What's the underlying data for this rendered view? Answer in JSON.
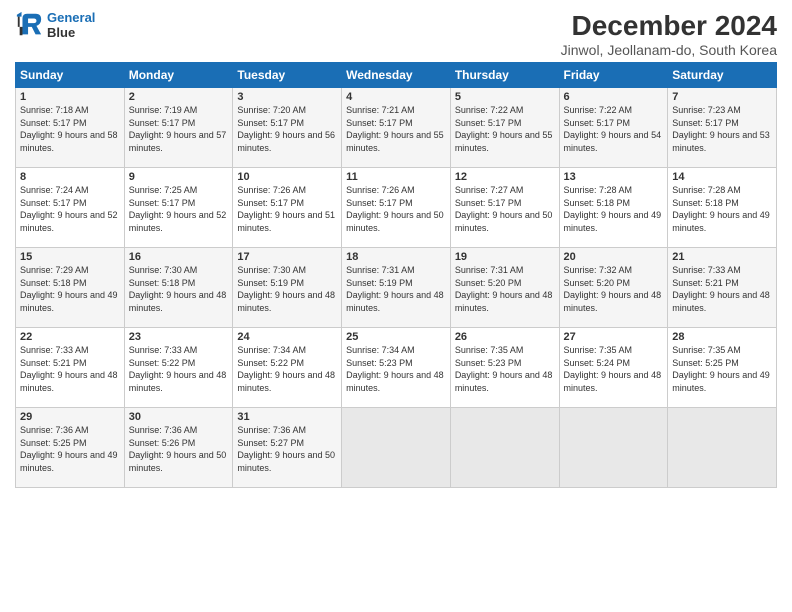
{
  "header": {
    "logo_line1": "General",
    "logo_line2": "Blue",
    "title": "December 2024",
    "subtitle": "Jinwol, Jeollanam-do, South Korea"
  },
  "calendar": {
    "days_of_week": [
      "Sunday",
      "Monday",
      "Tuesday",
      "Wednesday",
      "Thursday",
      "Friday",
      "Saturday"
    ],
    "weeks": [
      [
        {
          "day": "",
          "empty": true
        },
        {
          "day": "",
          "empty": true
        },
        {
          "day": "",
          "empty": true
        },
        {
          "day": "",
          "empty": true
        },
        {
          "day": "",
          "empty": true
        },
        {
          "day": "",
          "empty": true
        },
        {
          "day": "",
          "empty": true
        }
      ],
      [
        {
          "day": "1",
          "sunrise": "Sunrise: 7:18 AM",
          "sunset": "Sunset: 5:17 PM",
          "daylight": "Daylight: 9 hours and 58 minutes."
        },
        {
          "day": "2",
          "sunrise": "Sunrise: 7:19 AM",
          "sunset": "Sunset: 5:17 PM",
          "daylight": "Daylight: 9 hours and 57 minutes."
        },
        {
          "day": "3",
          "sunrise": "Sunrise: 7:20 AM",
          "sunset": "Sunset: 5:17 PM",
          "daylight": "Daylight: 9 hours and 56 minutes."
        },
        {
          "day": "4",
          "sunrise": "Sunrise: 7:21 AM",
          "sunset": "Sunset: 5:17 PM",
          "daylight": "Daylight: 9 hours and 55 minutes."
        },
        {
          "day": "5",
          "sunrise": "Sunrise: 7:22 AM",
          "sunset": "Sunset: 5:17 PM",
          "daylight": "Daylight: 9 hours and 55 minutes."
        },
        {
          "day": "6",
          "sunrise": "Sunrise: 7:22 AM",
          "sunset": "Sunset: 5:17 PM",
          "daylight": "Daylight: 9 hours and 54 minutes."
        },
        {
          "day": "7",
          "sunrise": "Sunrise: 7:23 AM",
          "sunset": "Sunset: 5:17 PM",
          "daylight": "Daylight: 9 hours and 53 minutes."
        }
      ],
      [
        {
          "day": "8",
          "sunrise": "Sunrise: 7:24 AM",
          "sunset": "Sunset: 5:17 PM",
          "daylight": "Daylight: 9 hours and 52 minutes."
        },
        {
          "day": "9",
          "sunrise": "Sunrise: 7:25 AM",
          "sunset": "Sunset: 5:17 PM",
          "daylight": "Daylight: 9 hours and 52 minutes."
        },
        {
          "day": "10",
          "sunrise": "Sunrise: 7:26 AM",
          "sunset": "Sunset: 5:17 PM",
          "daylight": "Daylight: 9 hours and 51 minutes."
        },
        {
          "day": "11",
          "sunrise": "Sunrise: 7:26 AM",
          "sunset": "Sunset: 5:17 PM",
          "daylight": "Daylight: 9 hours and 50 minutes."
        },
        {
          "day": "12",
          "sunrise": "Sunrise: 7:27 AM",
          "sunset": "Sunset: 5:17 PM",
          "daylight": "Daylight: 9 hours and 50 minutes."
        },
        {
          "day": "13",
          "sunrise": "Sunrise: 7:28 AM",
          "sunset": "Sunset: 5:18 PM",
          "daylight": "Daylight: 9 hours and 49 minutes."
        },
        {
          "day": "14",
          "sunrise": "Sunrise: 7:28 AM",
          "sunset": "Sunset: 5:18 PM",
          "daylight": "Daylight: 9 hours and 49 minutes."
        }
      ],
      [
        {
          "day": "15",
          "sunrise": "Sunrise: 7:29 AM",
          "sunset": "Sunset: 5:18 PM",
          "daylight": "Daylight: 9 hours and 49 minutes."
        },
        {
          "day": "16",
          "sunrise": "Sunrise: 7:30 AM",
          "sunset": "Sunset: 5:18 PM",
          "daylight": "Daylight: 9 hours and 48 minutes."
        },
        {
          "day": "17",
          "sunrise": "Sunrise: 7:30 AM",
          "sunset": "Sunset: 5:19 PM",
          "daylight": "Daylight: 9 hours and 48 minutes."
        },
        {
          "day": "18",
          "sunrise": "Sunrise: 7:31 AM",
          "sunset": "Sunset: 5:19 PM",
          "daylight": "Daylight: 9 hours and 48 minutes."
        },
        {
          "day": "19",
          "sunrise": "Sunrise: 7:31 AM",
          "sunset": "Sunset: 5:20 PM",
          "daylight": "Daylight: 9 hours and 48 minutes."
        },
        {
          "day": "20",
          "sunrise": "Sunrise: 7:32 AM",
          "sunset": "Sunset: 5:20 PM",
          "daylight": "Daylight: 9 hours and 48 minutes."
        },
        {
          "day": "21",
          "sunrise": "Sunrise: 7:33 AM",
          "sunset": "Sunset: 5:21 PM",
          "daylight": "Daylight: 9 hours and 48 minutes."
        }
      ],
      [
        {
          "day": "22",
          "sunrise": "Sunrise: 7:33 AM",
          "sunset": "Sunset: 5:21 PM",
          "daylight": "Daylight: 9 hours and 48 minutes."
        },
        {
          "day": "23",
          "sunrise": "Sunrise: 7:33 AM",
          "sunset": "Sunset: 5:22 PM",
          "daylight": "Daylight: 9 hours and 48 minutes."
        },
        {
          "day": "24",
          "sunrise": "Sunrise: 7:34 AM",
          "sunset": "Sunset: 5:22 PM",
          "daylight": "Daylight: 9 hours and 48 minutes."
        },
        {
          "day": "25",
          "sunrise": "Sunrise: 7:34 AM",
          "sunset": "Sunset: 5:23 PM",
          "daylight": "Daylight: 9 hours and 48 minutes."
        },
        {
          "day": "26",
          "sunrise": "Sunrise: 7:35 AM",
          "sunset": "Sunset: 5:23 PM",
          "daylight": "Daylight: 9 hours and 48 minutes."
        },
        {
          "day": "27",
          "sunrise": "Sunrise: 7:35 AM",
          "sunset": "Sunset: 5:24 PM",
          "daylight": "Daylight: 9 hours and 48 minutes."
        },
        {
          "day": "28",
          "sunrise": "Sunrise: 7:35 AM",
          "sunset": "Sunset: 5:25 PM",
          "daylight": "Daylight: 9 hours and 49 minutes."
        }
      ],
      [
        {
          "day": "29",
          "sunrise": "Sunrise: 7:36 AM",
          "sunset": "Sunset: 5:25 PM",
          "daylight": "Daylight: 9 hours and 49 minutes."
        },
        {
          "day": "30",
          "sunrise": "Sunrise: 7:36 AM",
          "sunset": "Sunset: 5:26 PM",
          "daylight": "Daylight: 9 hours and 50 minutes."
        },
        {
          "day": "31",
          "sunrise": "Sunrise: 7:36 AM",
          "sunset": "Sunset: 5:27 PM",
          "daylight": "Daylight: 9 hours and 50 minutes."
        },
        {
          "day": "",
          "empty": true
        },
        {
          "day": "",
          "empty": true
        },
        {
          "day": "",
          "empty": true
        },
        {
          "day": "",
          "empty": true
        }
      ]
    ]
  }
}
